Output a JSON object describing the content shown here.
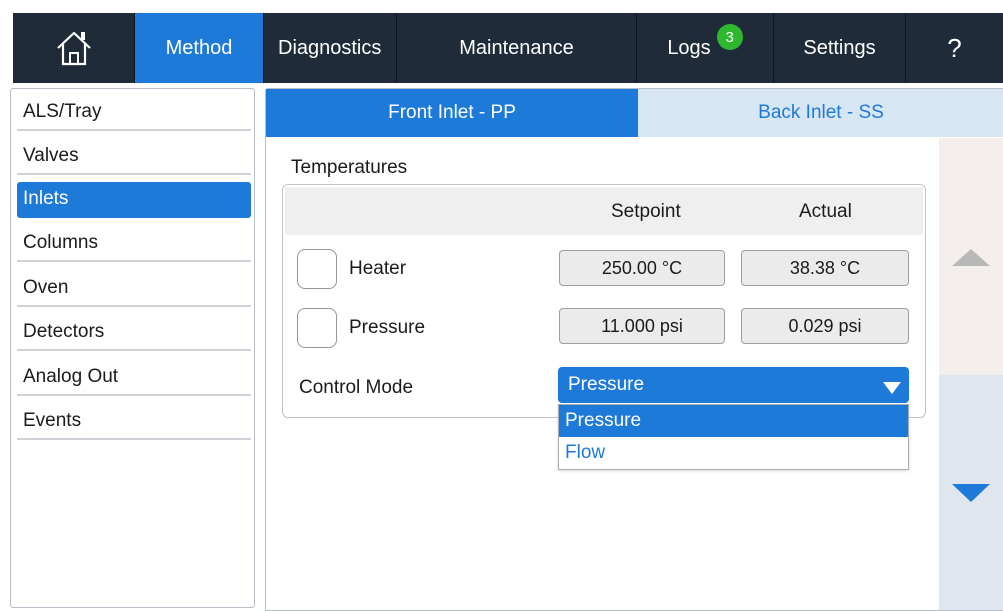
{
  "topnav": {
    "home_icon": "home-icon",
    "items": [
      "Method",
      "Diagnostics",
      "Maintenance",
      "Logs",
      "Settings"
    ],
    "logs_badge": "3",
    "help": "?",
    "active": "Method",
    "colors": {
      "bar": "#1f2b39",
      "active": "#1e7ad8",
      "badge": "#2eb82e"
    }
  },
  "sidebar": {
    "items": [
      "ALS/Tray",
      "Valves",
      "Inlets",
      "Columns",
      "Oven",
      "Detectors",
      "Analog Out",
      "Events"
    ],
    "active": "Inlets"
  },
  "tabs": {
    "front": "Front Inlet - PP",
    "back": "Back Inlet - SS",
    "active": "Front Inlet - PP"
  },
  "temperatures": {
    "title": "Temperatures",
    "col_setpoint": "Setpoint",
    "col_actual": "Actual",
    "rows": [
      {
        "label": "Heater",
        "setpoint": "250.00 °C",
        "actual": "38.38 °C",
        "checked": false
      },
      {
        "label": "Pressure",
        "setpoint": "11.000 psi",
        "actual": "0.029 psi",
        "checked": false
      }
    ],
    "control_mode_label": "Control Mode",
    "control_mode_value": "Pressure",
    "control_mode_options": [
      "Pressure",
      "Flow"
    ]
  },
  "scroll": {
    "up_icon": "triangle-up-icon",
    "down_icon": "triangle-down-icon"
  }
}
